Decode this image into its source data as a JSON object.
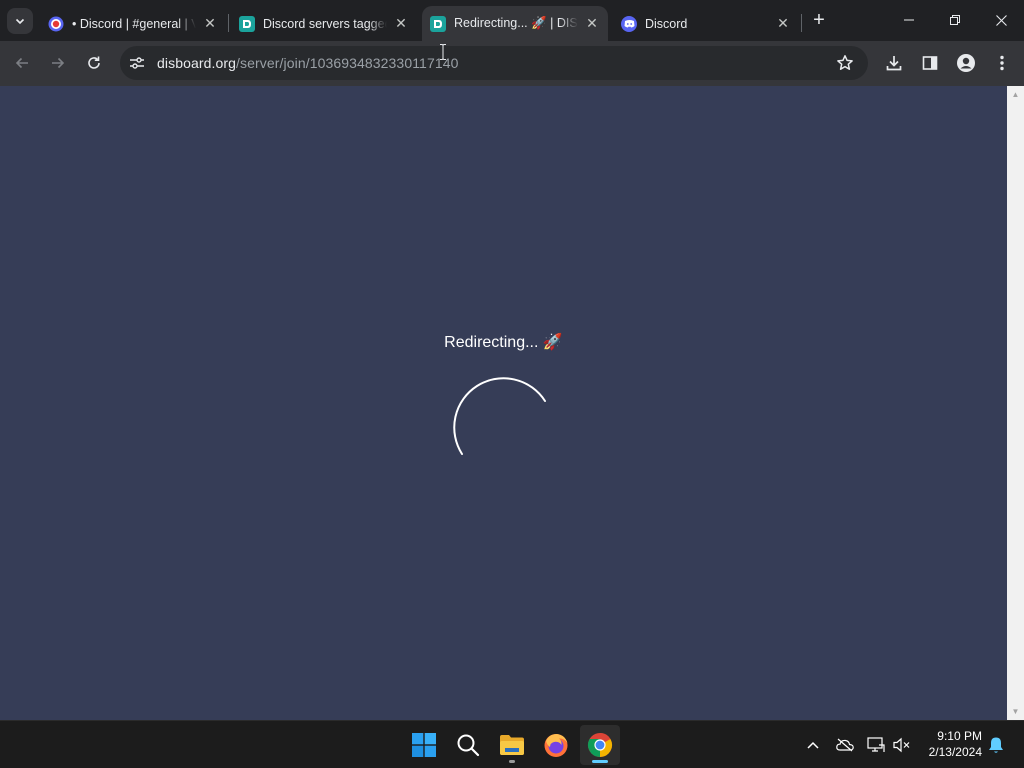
{
  "browser": {
    "tabs": [
      {
        "title": "• Discord | #general | V",
        "active": false,
        "favicon": "discord-red-icon"
      },
      {
        "title": "Discord servers tagged",
        "active": false,
        "favicon": "disboard-icon"
      },
      {
        "title": "Redirecting... 🚀 | DISBOARD",
        "active": true,
        "favicon": "disboard-icon"
      },
      {
        "title": "Discord",
        "active": false,
        "favicon": "discord-icon"
      }
    ],
    "new_tab_label": "+",
    "address": {
      "host": "disboard.org",
      "path": "/server/join/1036934832330117140"
    }
  },
  "page": {
    "message": "Redirecting... 🚀",
    "background": "#363d57"
  },
  "taskbar": {
    "apps": [
      "start-icon",
      "search-icon",
      "file-explorer-icon",
      "firefox-icon",
      "chrome-icon"
    ],
    "clock": {
      "time": "9:10 PM",
      "date": "2/13/2024"
    }
  },
  "colors": {
    "accent_chrome": "#8ab4f8",
    "disboard_teal": "#1ba39c",
    "discord_blurple": "#5865f2"
  }
}
